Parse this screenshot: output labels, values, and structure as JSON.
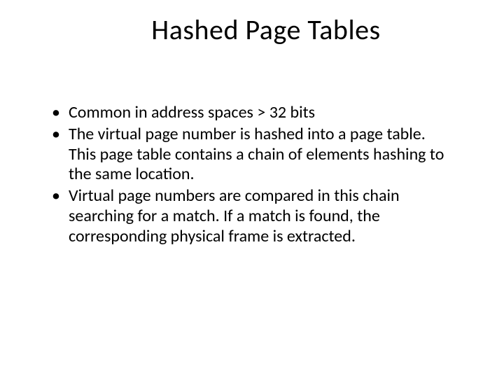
{
  "slide": {
    "title": "Hashed Page Tables",
    "bullets": [
      "Common in address spaces > 32 bits",
      "The virtual page number is hashed into a page table. This page table contains a chain of elements hashing to the same location.",
      "Virtual page numbers are compared in this chain searching for a match. If a match is found, the corresponding physical frame is extracted."
    ]
  }
}
